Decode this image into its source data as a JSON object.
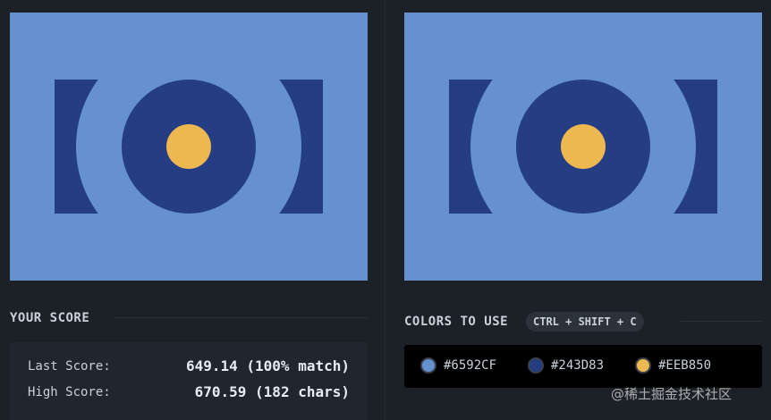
{
  "score": {
    "title": "YOUR SCORE",
    "last_label": "Last Score:",
    "last_value": "649.14 (100% match)",
    "high_label": "High Score:",
    "high_value": "670.59 (182 chars)"
  },
  "colors": {
    "title": "COLORS TO USE",
    "shortcut": "CTRL + SHIFT + C",
    "swatches": [
      {
        "hex": "#6592CF",
        "color": "#6592CF"
      },
      {
        "hex": "#243D83",
        "color": "#243D83"
      },
      {
        "hex": "#EEB850",
        "color": "#EEB850"
      }
    ]
  },
  "palette": {
    "page_bg": "#1c2128",
    "light": "#6592CF",
    "dark": "#243D83",
    "gold": "#EEB850"
  },
  "watermark": "@稀土掘金技术社区"
}
